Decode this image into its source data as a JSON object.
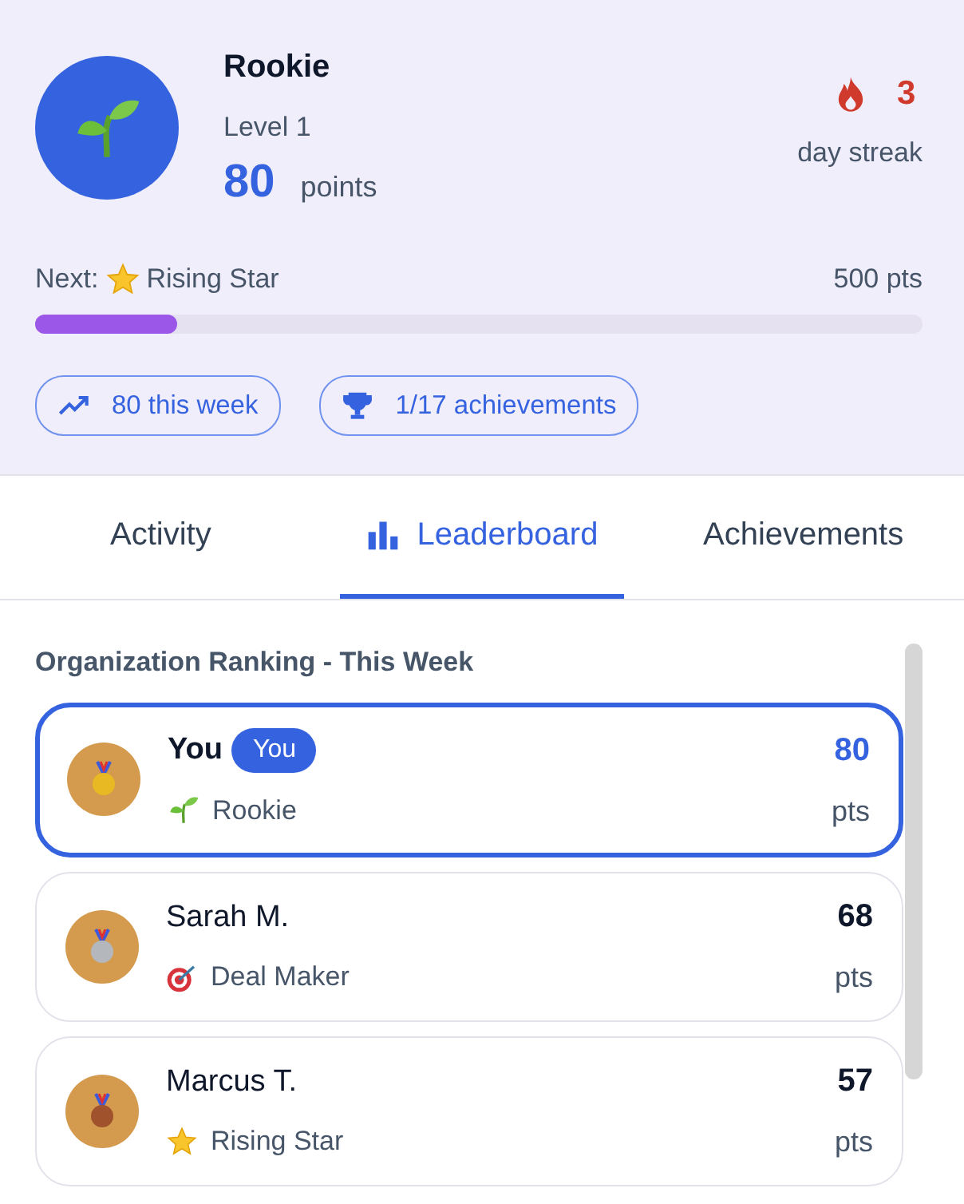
{
  "profile": {
    "rank_title": "Rookie",
    "level": "Level 1",
    "points": "80",
    "points_label": "points",
    "streak_count": "3",
    "streak_label": "day streak"
  },
  "next_rank": {
    "prefix": "Next:",
    "title": "Rising Star",
    "target": "500 pts",
    "level": 0.16
  },
  "pills": [
    {
      "kind": "trend",
      "label": "80 this week"
    },
    {
      "kind": "trophy",
      "label": "1/17 achievements"
    }
  ],
  "tabs": [
    {
      "label": "Activity",
      "kind": "plain",
      "selected": false
    },
    {
      "label": "Leaderboard",
      "kind": "chart",
      "selected": true
    },
    {
      "label": "Achievements",
      "kind": "plain",
      "selected": false
    }
  ],
  "leaderboard": {
    "heading": "Organization Ranking - This Week",
    "entries": [
      {
        "name": "You",
        "badge": "You",
        "selected": true,
        "color": "#e8b923",
        "kind": "seedling",
        "rank_title": "Rookie",
        "points": "80",
        "unit": "pts"
      },
      {
        "name": "Sarah M.",
        "selected": false,
        "color": "#b4b8bd",
        "kind": "target",
        "rank_title": "Deal Maker",
        "points": "68",
        "unit": "pts"
      },
      {
        "name": "Marcus T.",
        "selected": false,
        "color": "#a0522d",
        "kind": "star",
        "rank_title": "Rising Star",
        "points": "57",
        "unit": "pts"
      }
    ]
  }
}
